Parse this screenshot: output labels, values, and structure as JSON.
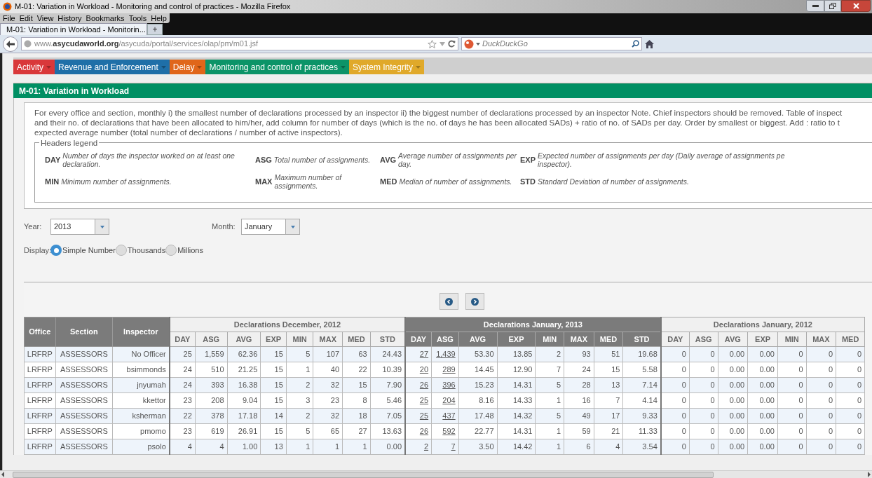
{
  "window": {
    "title": "M-01: Variation in Workload - Monitoring and control of practices - Mozilla Firefox"
  },
  "menu_bar": [
    "File",
    "Edit",
    "View",
    "History",
    "Bookmarks",
    "Tools",
    "Help"
  ],
  "tabs": [
    {
      "label": "M-01: Variation in Workload - Monitorin...",
      "selected": true
    }
  ],
  "new_tab": "+",
  "address_bar": {
    "url": "www.**asycudaworld.org**/asycuda/portal/services/olap/pm/m01.jsf"
  },
  "search": {
    "placeholder": "DuckDuckGo"
  },
  "nav_menu": [
    {
      "label": "Activity",
      "color": "#d9383a"
    },
    {
      "label": "Revenue and Enforcement",
      "color": "#1f6fa8"
    },
    {
      "label": "Delay",
      "color": "#e0661a"
    },
    {
      "label": "Monitoring and control of practices",
      "color": "#0c9468"
    },
    {
      "label": "System Integrity",
      "color": "#e0a92a"
    }
  ],
  "panel_title": "M-01: Variation in Workload",
  "description": [
    "For every office and section, monthly i) the smallest number of declarations processed by an inspector ii) the biggest number of declarations processed by an inspector Note. Chief inspectors should be removed. Table of inspect",
    "and their no. of declarations that have been allocated to him/her, add column for number of days (which is the no. of days he has been allocated SADs) + ratio of no. of SADs per day. Order by smallest or biggest. Add : ratio to t",
    "expected average number (total number of declarations / number of active inspectors)."
  ],
  "legend": {
    "title": "Headers legend",
    "items": [
      {
        "code": "DAY",
        "lines": [
          "Number of days the inspector worked on at least one",
          "declaration."
        ]
      },
      {
        "code": "ASG",
        "lines": [
          "Total number of assignments."
        ]
      },
      {
        "code": "AVG",
        "lines": [
          "Average number of assignments per",
          "day."
        ]
      },
      {
        "code": "EXP",
        "lines": [
          "Expected number of assignments per day (Daily average of assignments pe",
          "inspector)."
        ]
      },
      {
        "code": "MIN",
        "lines": [
          "Minimum number of assignments."
        ]
      },
      {
        "code": "MAX",
        "lines": [
          "Maximum number of",
          "assignments."
        ]
      },
      {
        "code": "MED",
        "lines": [
          "Median of number of assignments."
        ]
      },
      {
        "code": "STD",
        "lines": [
          "Standard Deviation of number of assignments."
        ]
      }
    ]
  },
  "filters": {
    "year_label": "Year:",
    "year": "2013",
    "month_label": "Month:",
    "month": "January",
    "display_label": "Display:",
    "display_options": [
      {
        "label": "Simple Number",
        "selected": true
      },
      {
        "label": "Thousands",
        "selected": false
      },
      {
        "label": "Millions",
        "selected": false
      }
    ]
  },
  "table": {
    "fixed_columns": [
      "Office",
      "Section",
      "Inspector"
    ],
    "groups": [
      {
        "title": "Declarations December, 2012",
        "selected": false,
        "columns": [
          {
            "label": "DAY",
            "link": false
          },
          {
            "label": "ASG",
            "link": false
          },
          {
            "label": "AVG",
            "link": false
          },
          {
            "label": "EXP",
            "link": false
          },
          {
            "label": "MIN",
            "link": false
          },
          {
            "label": "MAX",
            "link": false
          },
          {
            "label": "MED",
            "link": false
          },
          {
            "label": "STD",
            "link": false
          }
        ]
      },
      {
        "title": "Declarations January, 2013",
        "selected": true,
        "columns": [
          {
            "label": "DAY",
            "link": true
          },
          {
            "label": "ASG",
            "link": true
          },
          {
            "label": "AVG",
            "link": false
          },
          {
            "label": "EXP",
            "link": false
          },
          {
            "label": "MIN",
            "link": false
          },
          {
            "label": "MAX",
            "link": false
          },
          {
            "label": "MED",
            "link": false
          },
          {
            "label": "STD",
            "link": false
          }
        ]
      },
      {
        "title": "Declarations January, 2012",
        "selected": false,
        "columns": [
          {
            "label": "DAY",
            "link": false
          },
          {
            "label": "ASG",
            "link": false
          },
          {
            "label": "AVG",
            "link": false
          },
          {
            "label": "EXP",
            "link": false
          },
          {
            "label": "MIN",
            "link": false
          },
          {
            "label": "MAX",
            "link": false
          },
          {
            "label": "MED",
            "link": false
          }
        ]
      }
    ],
    "rows": [
      {
        "office": "LRFRP",
        "section": "ASSESSORS",
        "inspector": "No Officer",
        "values": [
          [
            "25",
            "1,559",
            "62.36",
            "15",
            "5",
            "107",
            "63",
            "24.43"
          ],
          [
            "27",
            "1,439",
            "53.30",
            "13.85",
            "2",
            "93",
            "51",
            "19.68"
          ],
          [
            "0",
            "0",
            "0.00",
            "0.00",
            "0",
            "0",
            "0"
          ]
        ]
      },
      {
        "office": "LRFRP",
        "section": "ASSESSORS",
        "inspector": "bsimmonds",
        "values": [
          [
            "24",
            "510",
            "21.25",
            "15",
            "1",
            "40",
            "22",
            "10.39"
          ],
          [
            "20",
            "289",
            "14.45",
            "12.90",
            "7",
            "24",
            "15",
            "5.58"
          ],
          [
            "0",
            "0",
            "0.00",
            "0.00",
            "0",
            "0",
            "0"
          ]
        ]
      },
      {
        "office": "LRFRP",
        "section": "ASSESSORS",
        "inspector": "jnyumah",
        "values": [
          [
            "24",
            "393",
            "16.38",
            "15",
            "2",
            "32",
            "15",
            "7.90"
          ],
          [
            "26",
            "396",
            "15.23",
            "14.31",
            "5",
            "28",
            "13",
            "7.14"
          ],
          [
            "0",
            "0",
            "0.00",
            "0.00",
            "0",
            "0",
            "0"
          ]
        ]
      },
      {
        "office": "LRFRP",
        "section": "ASSESSORS",
        "inspector": "kkettor",
        "values": [
          [
            "23",
            "208",
            "9.04",
            "15",
            "3",
            "23",
            "8",
            "5.46"
          ],
          [
            "25",
            "204",
            "8.16",
            "14.33",
            "1",
            "16",
            "7",
            "4.14"
          ],
          [
            "0",
            "0",
            "0.00",
            "0.00",
            "0",
            "0",
            "0"
          ]
        ]
      },
      {
        "office": "LRFRP",
        "section": "ASSESSORS",
        "inspector": "ksherman",
        "values": [
          [
            "22",
            "378",
            "17.18",
            "14",
            "2",
            "32",
            "18",
            "7.05"
          ],
          [
            "25",
            "437",
            "17.48",
            "14.32",
            "5",
            "49",
            "17",
            "9.33"
          ],
          [
            "0",
            "0",
            "0.00",
            "0.00",
            "0",
            "0",
            "0"
          ]
        ]
      },
      {
        "office": "LRFRP",
        "section": "ASSESSORS",
        "inspector": "pmomo",
        "values": [
          [
            "23",
            "619",
            "26.91",
            "15",
            "5",
            "65",
            "27",
            "13.63"
          ],
          [
            "26",
            "592",
            "22.77",
            "14.31",
            "1",
            "59",
            "21",
            "11.33"
          ],
          [
            "0",
            "0",
            "0.00",
            "0.00",
            "0",
            "0",
            "0"
          ]
        ]
      },
      {
        "office": "LRFRP",
        "section": "ASSESSORS",
        "inspector": "psolo",
        "values": [
          [
            "4",
            "4",
            "1.00",
            "13",
            "1",
            "1",
            "1",
            "0.00"
          ],
          [
            "2",
            "7",
            "3.50",
            "14.42",
            "1",
            "6",
            "4",
            "3.54"
          ],
          [
            "0",
            "0",
            "0.00",
            "0.00",
            "0",
            "0",
            "0"
          ]
        ]
      }
    ]
  }
}
